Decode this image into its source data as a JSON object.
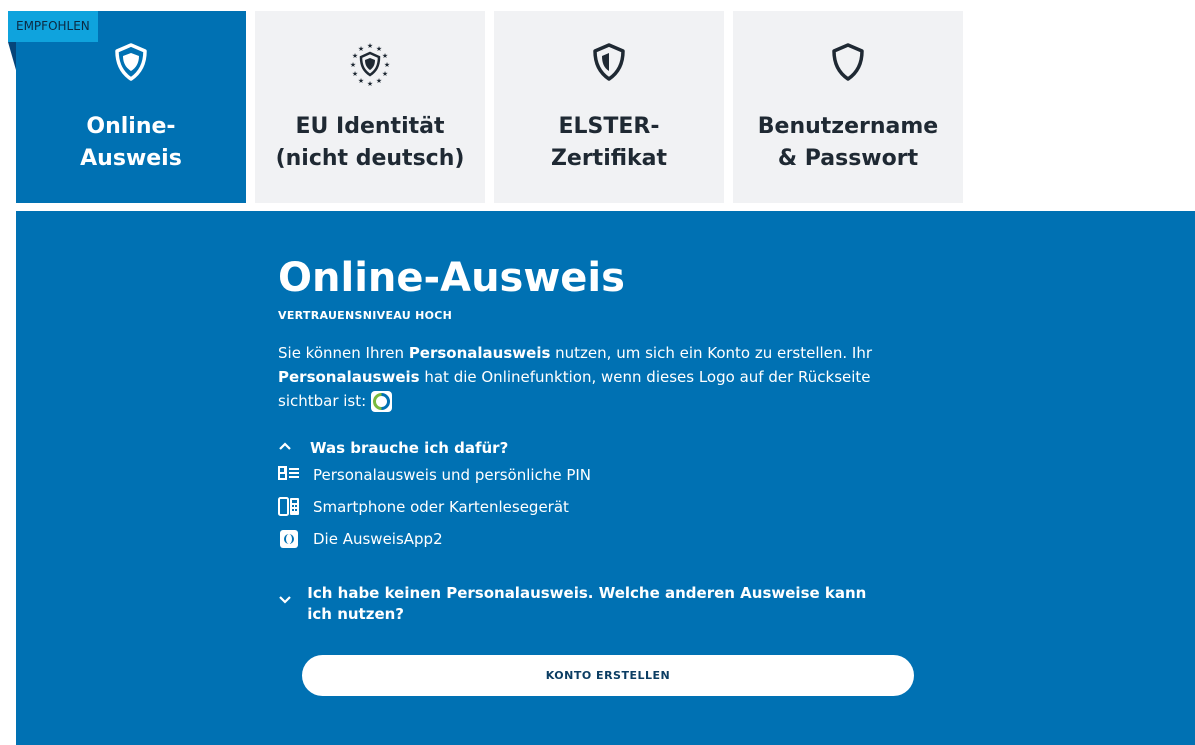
{
  "badge": "EMPFOHLEN",
  "tabs": [
    {
      "line1": "Online-",
      "line2": "Ausweis",
      "icon": "shield-check-icon"
    },
    {
      "line1": "EU Identität",
      "line2": "(nicht deutsch)",
      "icon": "eu-stars-shield-icon"
    },
    {
      "line1": "ELSTER-",
      "line2": "Zertifikat",
      "icon": "shield-half-icon"
    },
    {
      "line1": "Benutzername",
      "line2": "& Passwort",
      "icon": "shield-outline-icon"
    }
  ],
  "panel": {
    "title": "Online-Ausweis",
    "level": "VERTRAUENSNIVEAU HOCH",
    "desc": {
      "p1": "Sie können Ihren ",
      "b1": "Personalausweis",
      "p2": " nutzen, um sich ein Konto zu erstellen. Ihr ",
      "b2": "Personalausweis",
      "p3": " hat die Onlinefunktion, wenn dieses Logo auf der Rückseite sichtbar ist:"
    },
    "accordion_open": "Was brauche ich dafür?",
    "requirements": [
      {
        "label": "Personalausweis und persönliche PIN",
        "icon": "id-card-icon"
      },
      {
        "label": "Smartphone oder Kartenlesegerät",
        "icon": "phone-cardreader-icon"
      },
      {
        "label": "Die AusweisApp2",
        "icon": "ausweisapp-icon"
      }
    ],
    "accordion_closed": "Ich habe keinen Personalausweis. Welche anderen Ausweise kann ich nutzen?",
    "button": "KONTO ERSTELLEN"
  },
  "colors": {
    "primary": "#0071b3",
    "badge": "#0fa3dd",
    "tab_bg": "#f1f2f4",
    "logo_green": "#7ab93d"
  }
}
